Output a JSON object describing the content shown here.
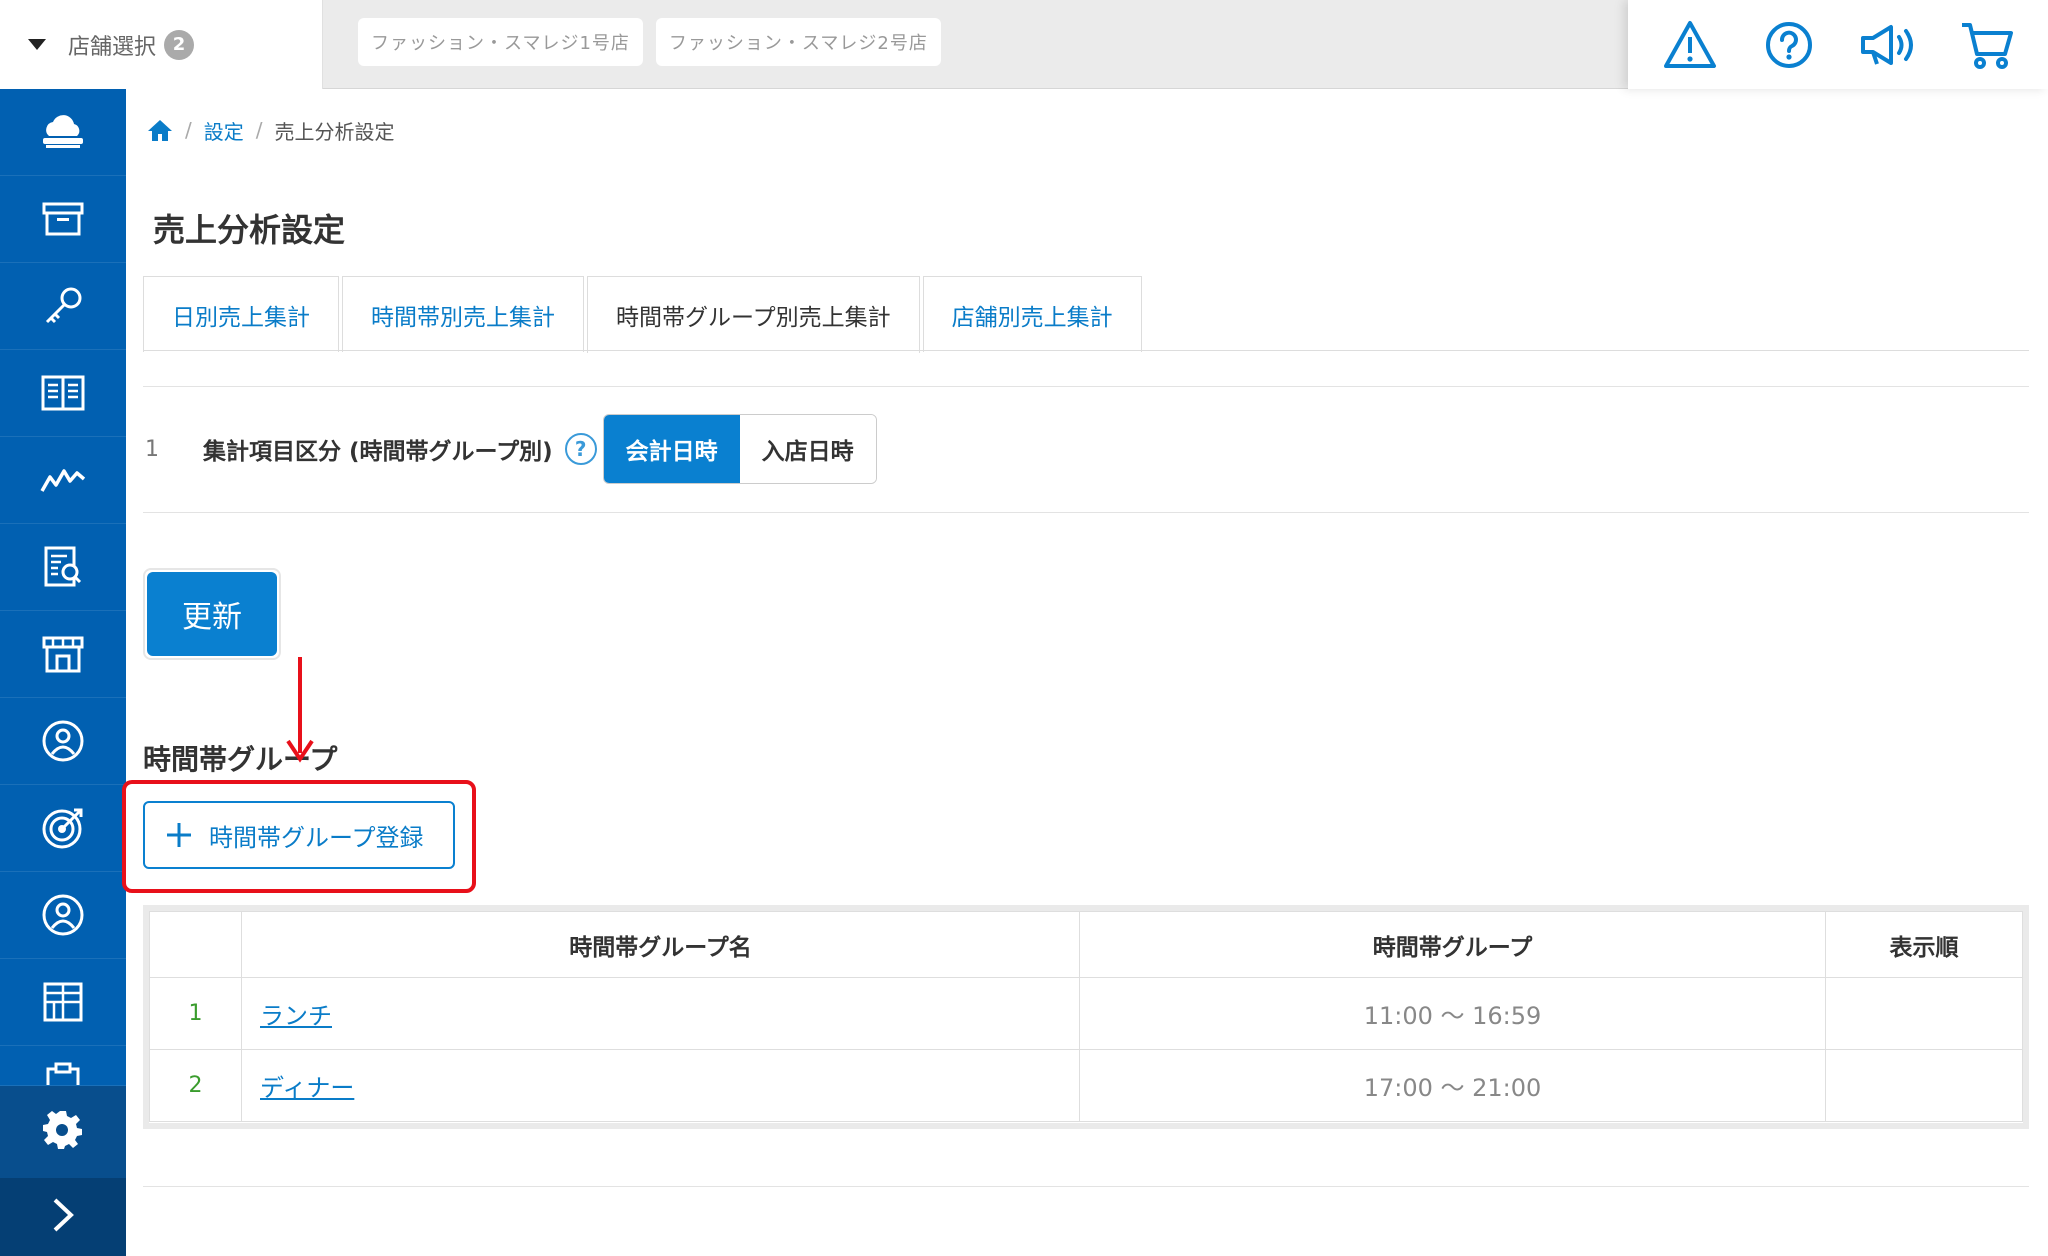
{
  "header": {
    "store_select_label": "店舗選択",
    "store_count": "2",
    "store_chips": [
      "ファッション・スマレジ1号店",
      "ファッション・スマレジ2号店"
    ],
    "icons": [
      "warning-icon",
      "help-icon",
      "megaphone-icon",
      "cart-icon"
    ],
    "accent_color": "#0a80d0"
  },
  "sidebar": {
    "items": [
      "cloud-register-icon",
      "archive-box-icon",
      "key-icon",
      "book-icon",
      "trend-chart-icon",
      "report-search-icon",
      "store-icon",
      "customer-icon",
      "target-icon",
      "member-icon",
      "grid-apps-icon",
      "clipboard-icon"
    ],
    "settings_icon": "gear-icon",
    "expand_icon": "chevron-right-icon",
    "color": "#0160b1"
  },
  "breadcrumb": {
    "home_icon": "home-icon",
    "sep": "/",
    "items": [
      "設定",
      "売上分析設定"
    ]
  },
  "page": {
    "title": "売上分析設定",
    "tabs": [
      "日別売上集計",
      "時間帯別売上集計",
      "時間帯グループ別売上集計",
      "店舗別売上集計"
    ],
    "active_tab": 2
  },
  "setting": {
    "number": "1",
    "label": "集計項目区分 (時間帯グループ別)",
    "help": "?",
    "options": [
      "会計日時",
      "入店日時"
    ],
    "selected": "会計日時"
  },
  "update_button": "更新",
  "section": {
    "title": "時間帯グループ",
    "add_button": "時間帯グループ登録"
  },
  "table": {
    "headers": [
      "",
      "時間帯グループ名",
      "時間帯グループ",
      "表示順"
    ],
    "rows": [
      {
        "no": "1",
        "name": "ランチ",
        "range": "11:00 〜 16:59",
        "order": ""
      },
      {
        "no": "2",
        "name": "ディナー",
        "range": "17:00 〜 21:00",
        "order": ""
      }
    ]
  },
  "annotation_color": "#e8101a"
}
